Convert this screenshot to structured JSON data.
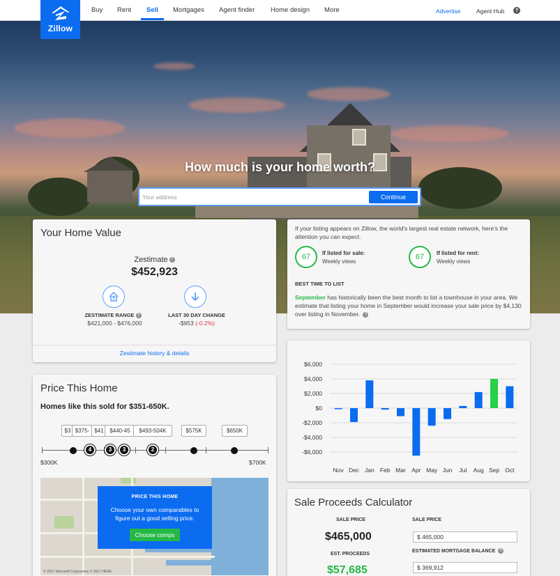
{
  "nav": {
    "logo_text": "Zillow",
    "items": [
      "Buy",
      "Rent",
      "Sell",
      "Mortgages",
      "Agent finder",
      "Home design",
      "More"
    ],
    "active": "Sell",
    "advertise": "Advertise",
    "agent_hub": "Agent Hub",
    "help": "?"
  },
  "hero": {
    "title": "How much is your home worth?",
    "search_placeholder": "Your address",
    "continue_label": "Continue"
  },
  "home_value": {
    "title": "Your Home Value",
    "zestimate_label": "Zestimate",
    "zestimate_value": "$452,923",
    "range_label": "ZESTIMATE RANGE",
    "range_value": "$421,000 - $476,000",
    "change_label": "LAST 30 DAY CHANGE",
    "change_value": "-$953",
    "change_pct": "(-0.2%)",
    "link": "Zestimate history & details"
  },
  "listing": {
    "intro": "If your listing appears on Zillow, the world's largest real estate network, here's the attention you can expect.",
    "sale_views": "67",
    "sale_label": "If listed for sale:",
    "sale_sub": "Weekly views",
    "rent_views": "67",
    "rent_label": "If listed for rent:",
    "rent_sub": "Weekly views",
    "best_time_label": "BEST TIME TO LIST",
    "best_month": "September",
    "best_text": " has historically been the best month to list a townhouse in your area. We estimate that listing your home in September would increase your sale price by $4,130 over listing in November."
  },
  "chart_data": {
    "type": "bar",
    "categories": [
      "Nov",
      "Dec",
      "Jan",
      "Feb",
      "Mar",
      "Apr",
      "May",
      "Jun",
      "Jul",
      "Aug",
      "Sep",
      "Oct"
    ],
    "values": [
      -100,
      -1900,
      3800,
      -200,
      -1100,
      -6500,
      -2400,
      -1500,
      300,
      2200,
      4000,
      3000
    ],
    "highlight": "Sep",
    "ylim": [
      -7000,
      7000
    ],
    "yticks": [
      "$6,000",
      "$4,000",
      "$2,000",
      "$0",
      "-$2,000",
      "-$4,000",
      "-$6,000"
    ],
    "ytick_values": [
      6000,
      4000,
      2000,
      0,
      -2000,
      -4000,
      -6000
    ],
    "grid": true,
    "colors": {
      "default": "#0c6cf0",
      "highlight": "#26d047"
    }
  },
  "price_home": {
    "title": "Price This Home",
    "subtitle": "Homes like this sold for $351-650K.",
    "pills": [
      "$3",
      "$375-",
      "$41",
      "$440-45",
      "$493-504K",
      "$575K",
      "$650K"
    ],
    "counts": [
      "4",
      "3",
      "3",
      "2"
    ],
    "min_label": "$300K",
    "max_label": "$700K",
    "overlay_title": "PRICE THIS HOME",
    "overlay_text": "Choose your own comparables to figure out a good selling price.",
    "comps_label": "Choose comps",
    "map_credit": "© 2017 Microsoft Corporation © 2017 HERE"
  },
  "sale_proceeds": {
    "title": "Sale Proceeds Calculator",
    "sale_price_label": "SALE PRICE",
    "sale_price_value": "$465,000",
    "proceeds_label": "EST. PROCEEDS",
    "proceeds_value": "$57,685",
    "input_sale_price_label": "SALE PRICE",
    "input_sale_price": "465,000",
    "mortgage_label": "ESTIMATED MORTGAGE BALANCE",
    "mortgage_value": "369,912",
    "currency": "$"
  }
}
